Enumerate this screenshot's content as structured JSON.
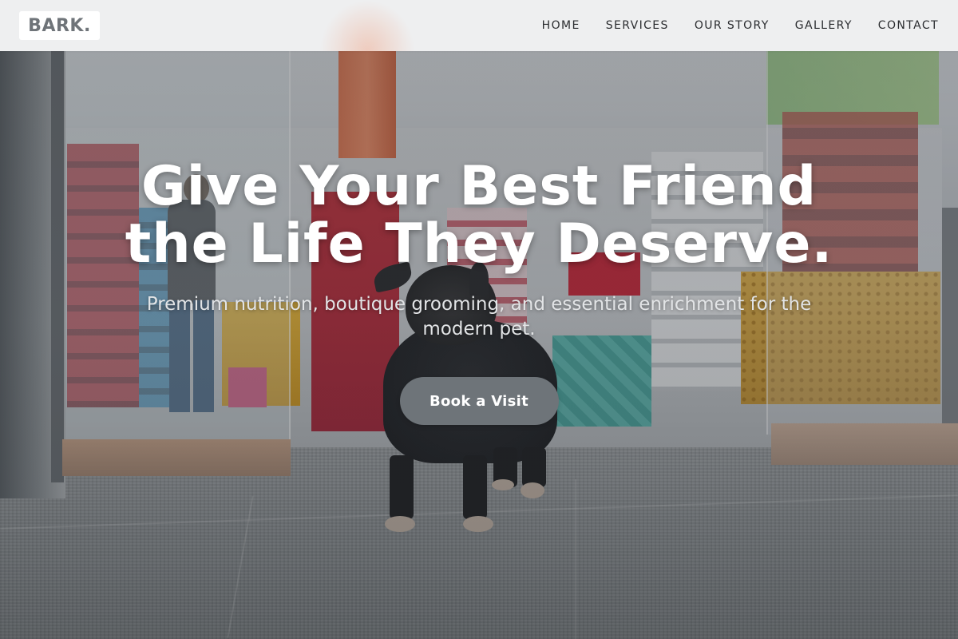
{
  "header": {
    "logo": "BARK.",
    "nav": [
      {
        "label": "HOME"
      },
      {
        "label": "SERVICES"
      },
      {
        "label": "OUR STORY"
      },
      {
        "label": "GALLERY"
      },
      {
        "label": "CONTACT"
      }
    ]
  },
  "hero": {
    "title": "Give Your Best Friend the Life They Deserve.",
    "subtitle": "Premium nutrition, boutique grooming, and essential enrichment for the modern pet.",
    "cta_label": "Book a Visit",
    "background_image": "dog standing at the entrance of a pet store"
  },
  "colors": {
    "header_bg": "#f4f5f6",
    "logo_text": "#6f7479",
    "nav_text": "#2a2c2f",
    "cta_bg": "#6e7479",
    "title_text": "#ffffff",
    "subtitle_text": "#e2e4e6"
  }
}
